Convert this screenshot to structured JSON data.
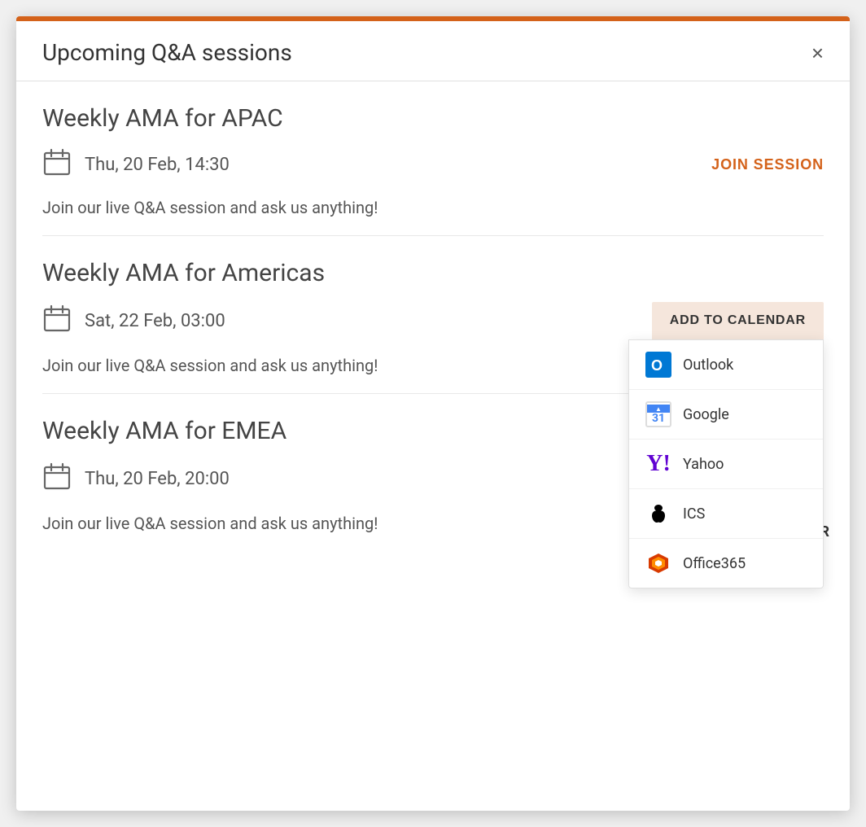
{
  "modal": {
    "title": "Upcoming Q&A sessions",
    "close_label": "×",
    "top_bar_color": "#d4621a"
  },
  "sessions": [
    {
      "id": "apac",
      "title": "Weekly AMA for APAC",
      "date": "Thu, 20 Feb, 14:30",
      "description": "Join our live Q&A session and ask us anything!",
      "action_label": "JOIN SESSION",
      "action_type": "join"
    },
    {
      "id": "americas",
      "title": "Weekly AMA for Americas",
      "date": "Sat, 22 Feb, 03:00",
      "description": "Join our live Q&A session and ask us anything!",
      "action_label": "ADD TO CALENDAR",
      "action_type": "calendar",
      "calendar_options": [
        {
          "id": "outlook",
          "label": "Outlook"
        },
        {
          "id": "google",
          "label": "Google"
        },
        {
          "id": "yahoo",
          "label": "Yahoo"
        },
        {
          "id": "ics",
          "label": "ICS"
        },
        {
          "id": "office365",
          "label": "Office365"
        }
      ]
    },
    {
      "id": "emea",
      "title": "Weekly AMA for EMEA",
      "date": "Thu, 20 Feb, 20:00",
      "description": "Join our live Q&A session and ask us anything!",
      "action_label": "ADD TO CALENDAR",
      "action_type": "calendar"
    }
  ],
  "colors": {
    "accent": "#d4621a",
    "join_color": "#d4621a",
    "add_cal_bg": "#f5e6dc",
    "text_primary": "#444",
    "text_secondary": "#555"
  }
}
